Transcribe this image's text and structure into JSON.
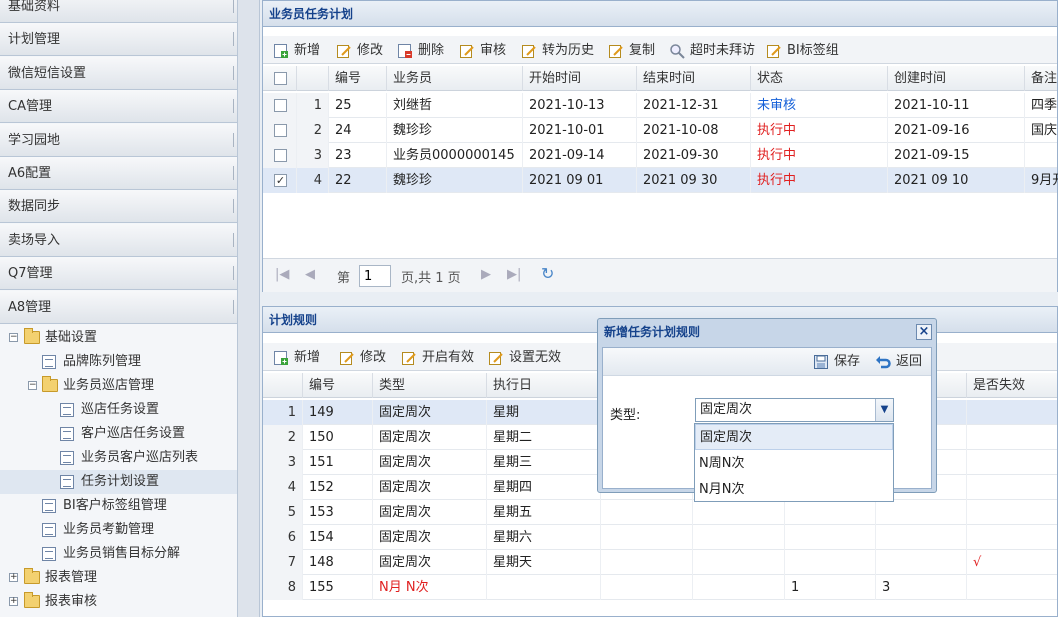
{
  "sidebar": {
    "accordion": [
      "基础资料",
      "计划管理",
      "微信短信设置",
      "CA管理",
      "学习园地",
      "A6配置",
      "数据同步",
      "卖场导入",
      "Q7管理",
      "A8管理"
    ],
    "tree": {
      "basic_settings": "基础设置",
      "brand_display": "品牌陈列管理",
      "salesman_visit": "业务员巡店管理",
      "visit_task_settings": "巡店任务设置",
      "customer_visit_task": "客户巡店任务设置",
      "salesman_customer_visit_list": "业务员客户巡店列表",
      "task_plan_settings": "任务计划设置",
      "bi_customer_tag": "BI客户标签组管理",
      "salesman_attendance": "业务员考勤管理",
      "salesman_sales_target": "业务员销售目标分解",
      "report_management": "报表管理",
      "report_review": "报表审核"
    }
  },
  "task_panel": {
    "title": "业务员任务计划",
    "toolbar": [
      "新增",
      "修改",
      "删除",
      "审核",
      "转为历史",
      "复制",
      "超时未拜访",
      "BI标签组"
    ],
    "columns": [
      "编号",
      "业务员",
      "开始时间",
      "结束时间",
      "状态",
      "创建时间",
      "备注"
    ],
    "rows": [
      {
        "rn": "1",
        "id": "25",
        "salesman": "刘继哲",
        "start": "2021-10-13",
        "end": "2021-12-31",
        "status": "未审核",
        "created": "2021-10-11",
        "note": "四季",
        "checked": false
      },
      {
        "rn": "2",
        "id": "24",
        "salesman": "魏珍珍",
        "start": "2021-10-01",
        "end": "2021-10-08",
        "status": "执行中",
        "created": "2021-09-16",
        "note": "国庆",
        "checked": false
      },
      {
        "rn": "3",
        "id": "23",
        "salesman": "业务员0000000145",
        "start": "2021-09-14",
        "end": "2021-09-30",
        "status": "执行中",
        "created": "2021-09-15",
        "note": "",
        "checked": false
      },
      {
        "rn": "4",
        "id": "22",
        "salesman": "魏珍珍",
        "start": "2021 09 01",
        "end": "2021 09 30",
        "status": "执行中",
        "created": "2021 09 10",
        "note": "9月开",
        "checked": true
      }
    ],
    "pager": {
      "page_label": "第",
      "page_value": "1",
      "total": "页,共 1 页"
    }
  },
  "rule_panel": {
    "title": "计划规则",
    "toolbar": [
      "新增",
      "修改",
      "开启有效",
      "设置无效"
    ],
    "columns": [
      "编号",
      "类型",
      "执行日",
      "",
      "",
      "",
      "是否失效"
    ],
    "rows": [
      {
        "rn": "1",
        "id": "149",
        "type": "固定周次",
        "day": "星期",
        "c4": "",
        "c5": "",
        "invalid": ""
      },
      {
        "rn": "2",
        "id": "150",
        "type": "固定周次",
        "day": "星期二",
        "c4": "",
        "c5": "",
        "invalid": ""
      },
      {
        "rn": "3",
        "id": "151",
        "type": "固定周次",
        "day": "星期三",
        "c4": "",
        "c5": "",
        "invalid": ""
      },
      {
        "rn": "4",
        "id": "152",
        "type": "固定周次",
        "day": "星期四",
        "c4": "",
        "c5": "",
        "invalid": ""
      },
      {
        "rn": "5",
        "id": "153",
        "type": "固定周次",
        "day": "星期五",
        "c4": "",
        "c5": "",
        "invalid": ""
      },
      {
        "rn": "6",
        "id": "154",
        "type": "固定周次",
        "day": "星期六",
        "c4": "",
        "c5": "",
        "invalid": ""
      },
      {
        "rn": "7",
        "id": "148",
        "type": "固定周次",
        "day": "星期天",
        "c4": "",
        "c5": "",
        "invalid": "√"
      },
      {
        "rn": "8",
        "id": "155",
        "type": "N月 N次",
        "day": "",
        "c4": "1",
        "c5": "3",
        "invalid": ""
      }
    ]
  },
  "dialog": {
    "title": "新增任务计划规则",
    "close": "×",
    "save": "保存",
    "back": "返回",
    "type_label": "类型:",
    "type_value": "固定周次",
    "options": [
      "固定周次",
      "N周N次",
      "N月N次"
    ]
  },
  "colors": {
    "status_pending": "#1560d8",
    "status_running": "#e02020",
    "title": "#15428b"
  }
}
